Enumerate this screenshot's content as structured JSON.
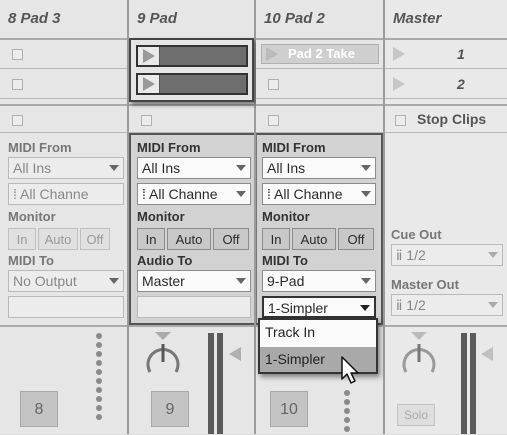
{
  "tracks": [
    {
      "title": "8 Pad 3",
      "midi_from_label": "MIDI From",
      "midi_from_value": "All Ins",
      "channel_value": "All Channe",
      "monitor_label": "Monitor",
      "monitor_options": [
        "In",
        "Auto",
        "Off"
      ],
      "midi_to_label": "MIDI To",
      "midi_to_value": "No Output",
      "track_number": "8"
    },
    {
      "title": "9 Pad",
      "midi_from_label": "MIDI From",
      "midi_from_value": "All Ins",
      "channel_value": "All Channe",
      "monitor_label": "Monitor",
      "monitor_options": [
        "In",
        "Auto",
        "Off"
      ],
      "audio_to_label": "Audio To",
      "audio_to_value": "Master",
      "track_number": "9"
    },
    {
      "title": "10 Pad 2",
      "clip_name": "Pad 2 Take",
      "midi_from_label": "MIDI From",
      "midi_from_value": "All Ins",
      "channel_value": "All Channe",
      "monitor_label": "Monitor",
      "monitor_options": [
        "In",
        "Auto",
        "Off"
      ],
      "midi_to_label": "MIDI To",
      "midi_to_value": "9-Pad",
      "midi_to_sub_value": "1-Simpler",
      "track_number": "10"
    }
  ],
  "master": {
    "title": "Master",
    "scene_numbers": [
      "1",
      "2"
    ],
    "stop_clips_label": "Stop Clips",
    "cue_out_label": "Cue Out",
    "cue_out_value": "1/2",
    "master_out_label": "Master Out",
    "master_out_value": "1/2",
    "solo_label": "Solo"
  },
  "dropdown_menu": {
    "options": [
      "Track In",
      "1-Simpler"
    ],
    "selected": "1-Simpler"
  },
  "colors": {
    "clip_fill": "#6e6e6e",
    "panel_bg": "#d2d2d2",
    "window_bg": "#dcdcdc",
    "selected_item": "#a9a9a9"
  }
}
